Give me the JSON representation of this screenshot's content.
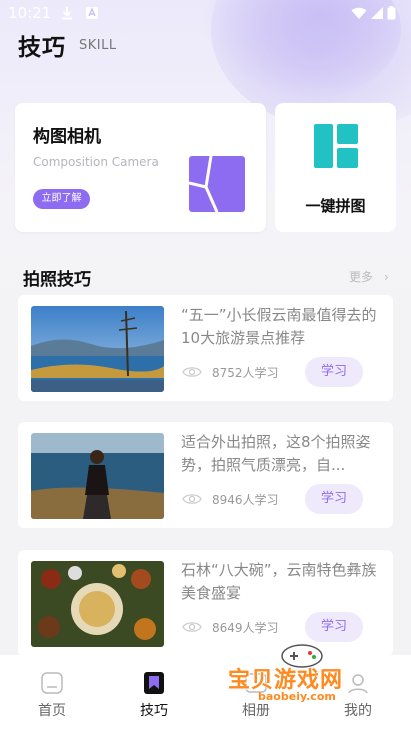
{
  "status_bar": {
    "time": "10:21"
  },
  "header": {
    "title": "技巧",
    "subtitle": "SKILL"
  },
  "feature_cards": {
    "composition": {
      "title": "构图相机",
      "subtitle": "Composition Camera",
      "button_label": "立即了解"
    },
    "collage": {
      "label": "一键拼图"
    }
  },
  "section": {
    "title": "拍照技巧",
    "more_label": "更多",
    "more_arrow": "›"
  },
  "articles": [
    {
      "title": "“五一”小长假云南最值得去的10大旅游景点推荐",
      "learners": "8752人学习",
      "button": "学习"
    },
    {
      "title": "适合外出拍照，这8个拍照姿势，拍照气质漂亮，自...",
      "learners": "8946人学习",
      "button": "学习"
    },
    {
      "title": "石林“八大碗”，云南特色彝族美食盛宴",
      "learners": "8649人学习",
      "button": "学习"
    }
  ],
  "tabbar": {
    "items": [
      {
        "label": "首页",
        "icon": "home-icon"
      },
      {
        "label": "技巧",
        "icon": "bookmark-icon"
      },
      {
        "label": "相册",
        "icon": "album-icon"
      },
      {
        "label": "我的",
        "icon": "profile-icon"
      }
    ]
  },
  "watermark": {
    "text": "宝贝游戏网",
    "url": "baobeiy.com"
  },
  "colors": {
    "accent": "#8e6cf2",
    "collage": "#22c1c3"
  }
}
